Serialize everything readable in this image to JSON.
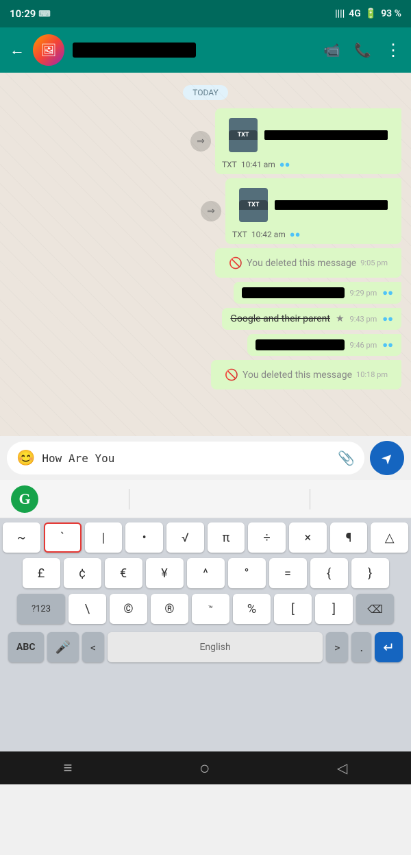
{
  "statusBar": {
    "time": "10:29",
    "signal": "4G",
    "battery": "93 %"
  },
  "header": {
    "contactName": "REDACTED",
    "icons": {
      "video": "📹",
      "phone": "📞",
      "more": "⋮"
    }
  },
  "chat": {
    "dateBadge": "TODAY",
    "messages": [
      {
        "type": "file-sent",
        "fileType": "TXT",
        "fileNameRedacted": true,
        "time": "10:41 am",
        "ticks": "blue-double"
      },
      {
        "type": "file-sent",
        "fileType": "TXT",
        "fileNameRedacted": true,
        "time": "10:42 am",
        "ticks": "blue-double"
      },
      {
        "type": "deleted-sent",
        "text": "You deleted this message",
        "time": "9:05 pm"
      },
      {
        "type": "text-sent",
        "textRedacted": true,
        "time": "9:29 pm",
        "ticks": "blue-double"
      },
      {
        "type": "text-sent-strikethrough",
        "text": "Google and their parent",
        "time": "9:43 pm",
        "ticks": "blue-double",
        "starred": true
      },
      {
        "type": "text-sent",
        "textRedacted": true,
        "time": "9:46 pm",
        "ticks": "blue-double"
      },
      {
        "type": "deleted-sent",
        "text": "You deleted this message",
        "time": "10:18 pm"
      }
    ]
  },
  "inputArea": {
    "placeholder": "How Are You",
    "emojiIcon": "😊",
    "attachIcon": "📎",
    "sendIcon": "➤"
  },
  "grammarly": {
    "letter": "G"
  },
  "keyboard": {
    "row1": [
      "~",
      "`",
      "|",
      "•",
      "√",
      "π",
      "÷",
      "×",
      "¶",
      "△"
    ],
    "row2": [
      "£",
      "¢",
      "€",
      "¥",
      "^",
      "°",
      "=",
      "{",
      "}"
    ],
    "row3Left": "?123",
    "row3Keys": [
      "\\",
      "©",
      "®",
      "™",
      "%",
      "[",
      "]"
    ],
    "row3Delete": "⌫",
    "bottomLeft": "ABC",
    "bottomMic": "🎤",
    "bottomLt": "<",
    "bottomSpace": "English",
    "bottomGt": ">",
    "bottomDot": ".",
    "bottomEnter": "↵"
  },
  "navBar": {
    "menu": "≡",
    "home": "○",
    "back": "◁"
  }
}
